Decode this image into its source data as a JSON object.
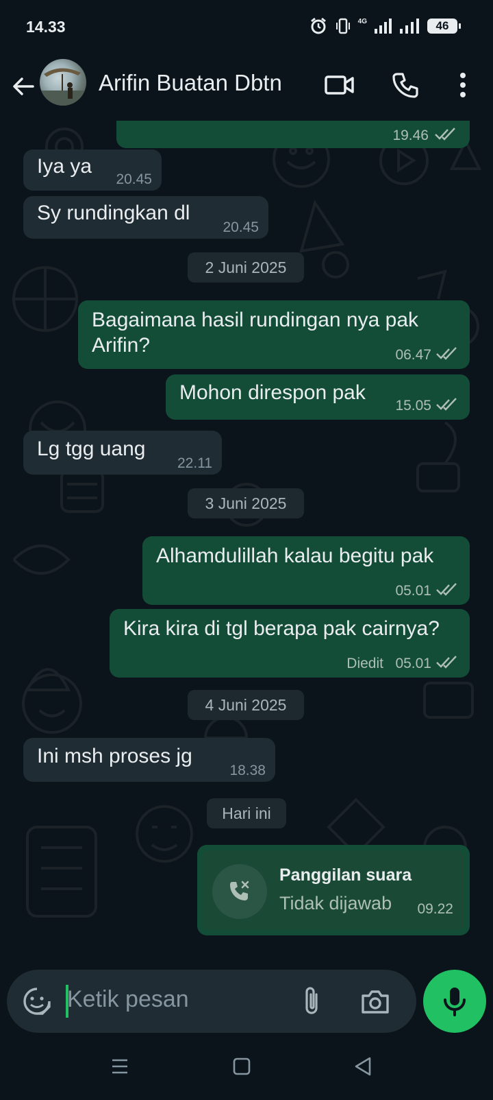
{
  "status_bar": {
    "time": "14.33",
    "network": "4G",
    "battery": "46"
  },
  "header": {
    "contact_name": "Arifin Buatan Dbtn"
  },
  "messages": [
    {
      "type": "out",
      "text": "",
      "time": "19.46"
    },
    {
      "type": "in",
      "text": "Iya ya",
      "time": "20.45"
    },
    {
      "type": "in",
      "text": "Sy rundingkan dl",
      "time": "20.45"
    },
    {
      "type": "date",
      "text": "2 Juni 2025"
    },
    {
      "type": "out",
      "text": "Bagaimana hasil rundingan nya pak Arifin?",
      "time": "06.47"
    },
    {
      "type": "out",
      "text": "Mohon direspon pak",
      "time": "15.05"
    },
    {
      "type": "in",
      "text": "Lg tgg uang",
      "time": "22.11"
    },
    {
      "type": "date",
      "text": "3 Juni 2025"
    },
    {
      "type": "out",
      "text": "Alhamdulillah kalau begitu pak",
      "time": "05.01"
    },
    {
      "type": "out",
      "text": "Kira kira di tgl berapa pak cairnya?",
      "edited": "Diedit",
      "time": "05.01"
    },
    {
      "type": "date",
      "text": "4 Juni 2025"
    },
    {
      "type": "in",
      "text": "Ini msh proses jg",
      "time": "18.38"
    },
    {
      "type": "date",
      "text": "Hari ini"
    },
    {
      "type": "call",
      "title": "Panggilan suara",
      "subtitle": "Tidak dijawab",
      "time": "09.22"
    }
  ],
  "composer": {
    "placeholder": "Ketik pesan"
  },
  "colors": {
    "background": "#0b141a",
    "incoming": "#202c33",
    "outgoing": "#144d37",
    "accent": "#21c063"
  }
}
